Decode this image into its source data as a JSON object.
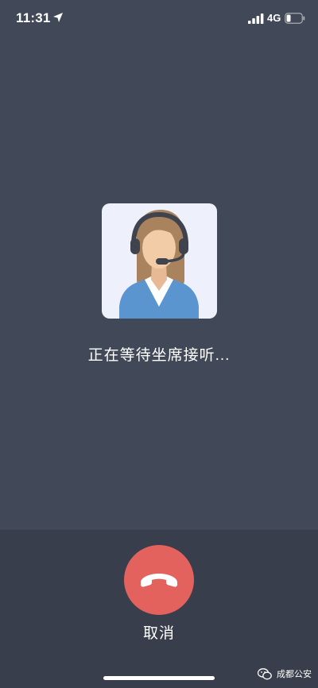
{
  "status_bar": {
    "time": "11:31",
    "network": "4G",
    "icons": [
      "location-arrow-icon",
      "signal-bars-icon",
      "battery-icon"
    ]
  },
  "call": {
    "status_text": "正在等待坐席接听...",
    "cancel_label": "取消",
    "hangup_icon": "phone-hangup-icon"
  },
  "watermark": {
    "text": "成都公安",
    "icon": "wechat-icon"
  },
  "colors": {
    "background": "#414958",
    "bottom_panel": "#383e4b",
    "hangup_button": "#e4625e",
    "card_background": "#eef0fb"
  }
}
